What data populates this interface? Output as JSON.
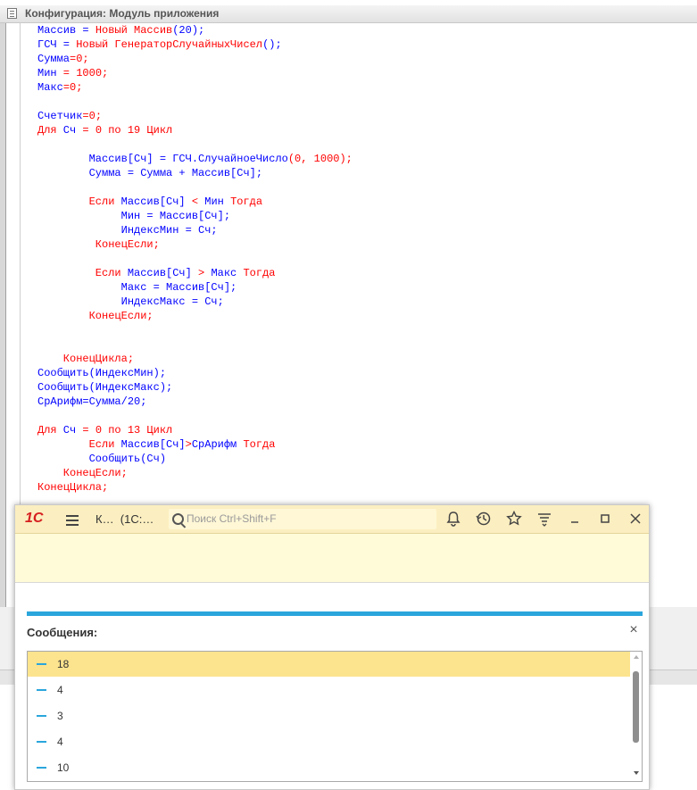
{
  "window": {
    "title": "Конфигурация: Модуль приложения"
  },
  "code": {
    "lines": [
      [
        {
          "t": "Массив = ",
          "c": "id"
        },
        {
          "t": "Новый Массив",
          "c": "kw"
        },
        {
          "t": "(20);",
          "c": "id"
        }
      ],
      [
        {
          "t": "ГСЧ = ",
          "c": "id"
        },
        {
          "t": "Новый ГенераторСлучайныхЧисел",
          "c": "kw"
        },
        {
          "t": "();",
          "c": "id"
        }
      ],
      [
        {
          "t": "Сумма",
          "c": "id"
        },
        {
          "t": "=0;",
          "c": "kw"
        }
      ],
      [
        {
          "t": "Мин",
          "c": "id"
        },
        {
          "t": " = 1000;",
          "c": "kw"
        }
      ],
      [
        {
          "t": "Макс",
          "c": "id"
        },
        {
          "t": "=0;",
          "c": "kw"
        }
      ],
      [],
      [
        {
          "t": "Счетчик",
          "c": "id"
        },
        {
          "t": "=0;",
          "c": "kw"
        }
      ],
      [
        {
          "t": "Для",
          "c": "kw"
        },
        {
          "t": " Сч ",
          "c": "id"
        },
        {
          "t": "= 0 ",
          "c": "kw"
        },
        {
          "t": "по",
          "c": "kw"
        },
        {
          "t": " 19 ",
          "c": "kw"
        },
        {
          "t": "Цикл",
          "c": "kw"
        }
      ],
      [],
      [
        {
          "t": "        Массив[Сч] = ГСЧ.СлучайноеЧисло",
          "c": "id"
        },
        {
          "t": "(0, 1000);",
          "c": "kw"
        }
      ],
      [
        {
          "t": "        Сумма = Сумма + Массив[Сч];",
          "c": "id"
        }
      ],
      [],
      [
        {
          "t": "        Если",
          "c": "kw"
        },
        {
          "t": " Массив[Сч] ",
          "c": "id"
        },
        {
          "t": "<",
          "c": "kw"
        },
        {
          "t": " Мин ",
          "c": "id"
        },
        {
          "t": "Тогда",
          "c": "kw"
        }
      ],
      [
        {
          "t": "             Мин = Массив[Сч];",
          "c": "id"
        }
      ],
      [
        {
          "t": "             ИндексМин = Сч;",
          "c": "id"
        }
      ],
      [
        {
          "t": "         КонецЕсли;",
          "c": "kw"
        }
      ],
      [],
      [
        {
          "t": "         Если",
          "c": "kw"
        },
        {
          "t": " Массив[Сч] ",
          "c": "id"
        },
        {
          "t": ">",
          "c": "kw"
        },
        {
          "t": " Макс ",
          "c": "id"
        },
        {
          "t": "Тогда",
          "c": "kw"
        }
      ],
      [
        {
          "t": "             Макс = Массив[Сч];",
          "c": "id"
        }
      ],
      [
        {
          "t": "             ИндексМакс = Сч;",
          "c": "id"
        }
      ],
      [
        {
          "t": "        КонецЕсли;",
          "c": "kw"
        }
      ],
      [],
      [],
      [
        {
          "t": "    КонецЦикла;",
          "c": "kw"
        }
      ],
      [
        {
          "t": "Сообщить(ИндексМин);",
          "c": "id"
        }
      ],
      [
        {
          "t": "Сообщить(ИндексМакс);",
          "c": "id"
        }
      ],
      [
        {
          "t": "СрАрифм=Сумма/20;",
          "c": "id"
        }
      ],
      [],
      [
        {
          "t": "Для",
          "c": "kw"
        },
        {
          "t": " Сч ",
          "c": "id"
        },
        {
          "t": "= 0 ",
          "c": "kw"
        },
        {
          "t": "по",
          "c": "kw"
        },
        {
          "t": " 13 ",
          "c": "kw"
        },
        {
          "t": "Цикл",
          "c": "kw"
        }
      ],
      [
        {
          "t": "        Если",
          "c": "kw"
        },
        {
          "t": " Массив[Сч]",
          "c": "id"
        },
        {
          "t": ">",
          "c": "kw"
        },
        {
          "t": "СрАрифм ",
          "c": "id"
        },
        {
          "t": "Тогда",
          "c": "kw"
        }
      ],
      [
        {
          "t": "        Сообщить(Сч)",
          "c": "id"
        }
      ],
      [
        {
          "t": "    КонецЕсли;",
          "c": "kw"
        }
      ],
      [
        {
          "t": "КонецЦикла;",
          "c": "kw"
        }
      ]
    ]
  },
  "app": {
    "logo": "1С",
    "tab_title": "К…  (1С:…",
    "search_placeholder": "Поиск Ctrl+Shift+F",
    "icons": [
      "bell-icon",
      "history-icon",
      "star-icon",
      "filter-icon",
      "minimize-icon",
      "maximize-icon",
      "close-icon"
    ]
  },
  "messages": {
    "title": "Сообщения:",
    "close": "×",
    "items": [
      "18",
      "4",
      "3",
      "4",
      "10"
    ],
    "selected_index": 0
  },
  "colors": {
    "keyword": "#ff0000",
    "identifier": "#0000ff",
    "accent": "#2aa6dc",
    "selection": "#fce38d",
    "logo": "#d61f1f"
  }
}
